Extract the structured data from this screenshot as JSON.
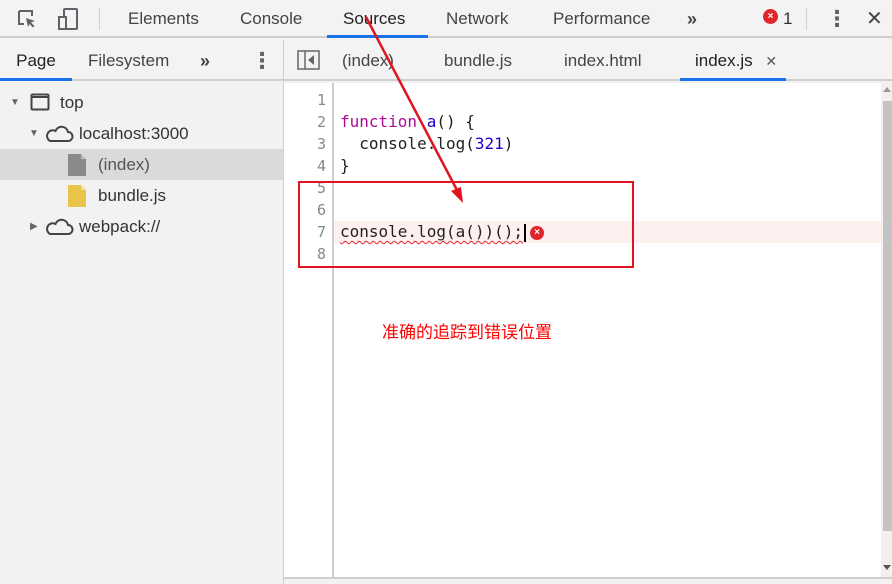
{
  "toolbar": {
    "icons": [
      "inspect-element-icon",
      "device-toolbar-icon"
    ],
    "tabs": [
      {
        "label": "Elements"
      },
      {
        "label": "Console"
      },
      {
        "label": "Sources",
        "active": true
      },
      {
        "label": "Network"
      },
      {
        "label": "Performance"
      }
    ],
    "more_tabs_label": "»",
    "error_count": "1",
    "error_badge_glyph": "×",
    "menu_icon": "⋮",
    "close_icon": "✕"
  },
  "navigator": {
    "tabs": [
      {
        "label": "Page",
        "active": true
      },
      {
        "label": "Filesystem"
      }
    ],
    "more_label": "»",
    "menu_icon": "⋮",
    "tree": [
      {
        "label": "top",
        "icon": "frame-icon",
        "expanded": true
      },
      {
        "label": "localhost:3000",
        "icon": "cloud-icon",
        "expanded": true
      },
      {
        "label": "(index)",
        "icon": "file-icon",
        "selected": true
      },
      {
        "label": "bundle.js",
        "icon": "js-file-icon"
      },
      {
        "label": "webpack://",
        "icon": "cloud-icon",
        "expanded": false
      }
    ]
  },
  "editor": {
    "toggle_navigator_icon": "sidebar-toggle-icon",
    "tabs": [
      {
        "label": "(index)"
      },
      {
        "label": "bundle.js"
      },
      {
        "label": "index.html"
      },
      {
        "label": "index.js",
        "active": true,
        "close": "✕"
      }
    ],
    "line_numbers": [
      "1",
      "2",
      "3",
      "4",
      "5",
      "6",
      "7",
      "8"
    ],
    "lines": {
      "l2_kw": "function",
      "l2_fn": "a",
      "l2_rest": "() {",
      "l3_pre": "  console.log(",
      "l3_num": "321",
      "l3_post": ")",
      "l4": "}",
      "l7": "console.log(a())();"
    },
    "error_line": 7,
    "error_glyph": "×"
  },
  "annotation": {
    "text": "准确的追踪到错误位置",
    "color": "#ff0000"
  }
}
